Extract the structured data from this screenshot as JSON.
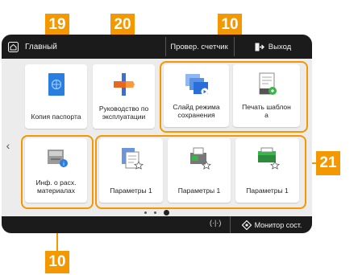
{
  "header": {
    "home_label": "Главный",
    "counter_label": "Провер. счетчик",
    "logout_label": "Выход"
  },
  "tiles": {
    "passport_copy": "Копия паспорта",
    "user_guide_line1": "Руководство по",
    "user_guide_line2": "эксплуатации",
    "scan_preset_line1": "Слайд режима",
    "scan_preset_line2": "сохранения",
    "print_template_line1": "Печать шаблон",
    "print_template_line2": "а",
    "consumables_line1": "Инф. о расх.",
    "consumables_line2": "материалах",
    "settings1_a": "Параметры 1",
    "settings1_b": "Параметры 1",
    "settings1_c": "Параметры 1"
  },
  "footer": {
    "monitor_label": "Монитор сост."
  },
  "pager": {
    "pages": 3,
    "current": 3
  },
  "callouts": {
    "c19": "19",
    "c20": "20",
    "c10_top": "10",
    "c21": "21",
    "c10_bottom": "10"
  },
  "colors": {
    "callout": "#f39800",
    "bar": "#1b1b1b",
    "panel": "#ececec",
    "accent_blue": "#2a7de1"
  }
}
